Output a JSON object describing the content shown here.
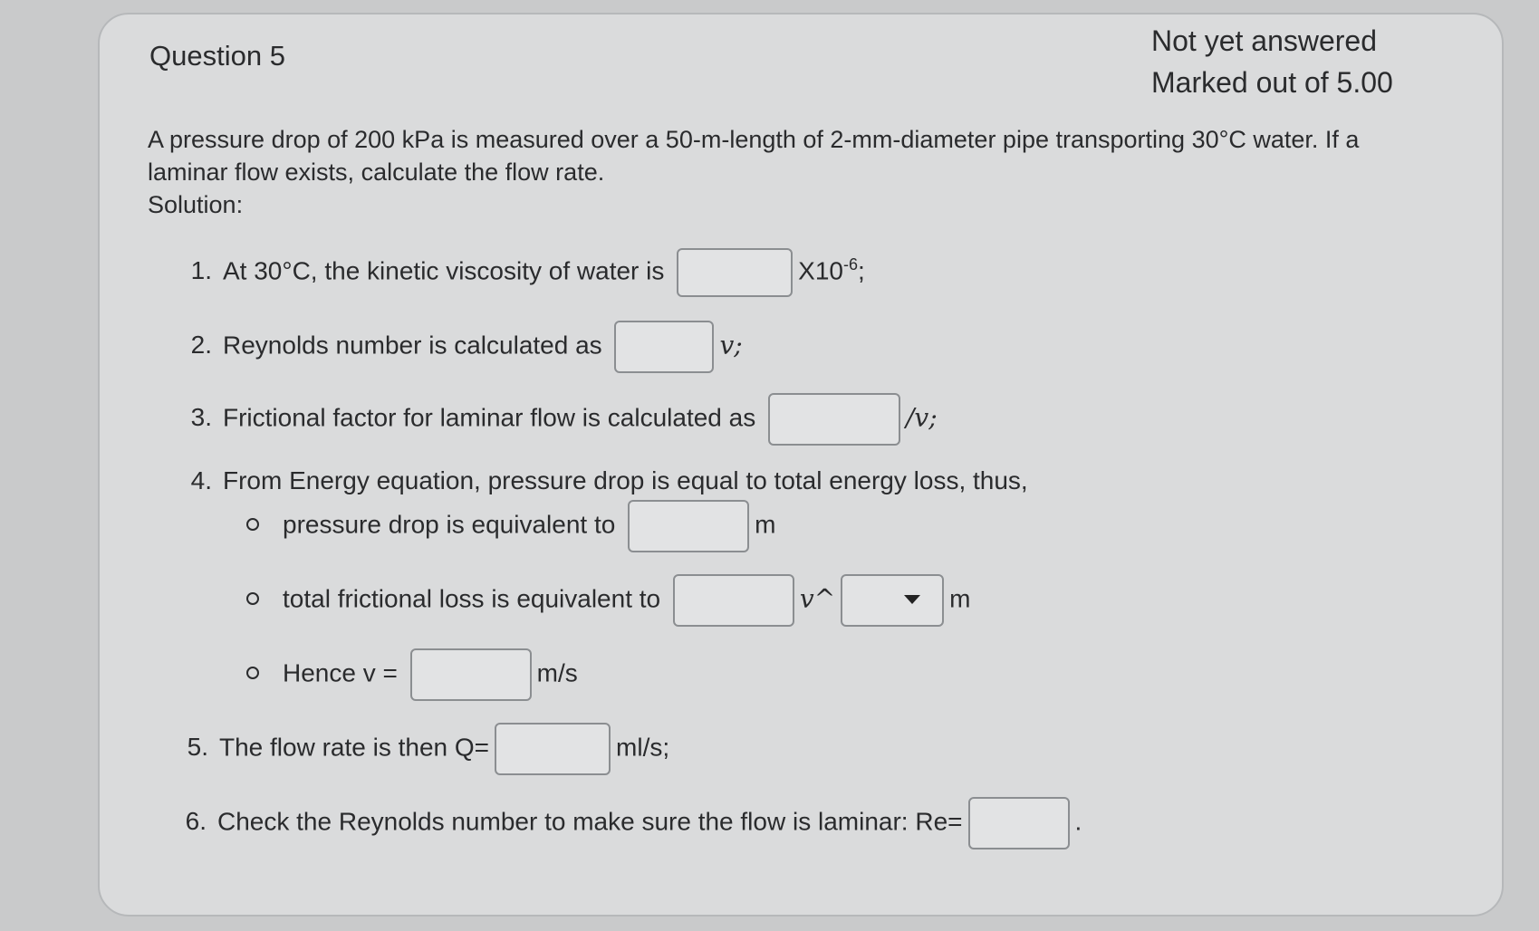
{
  "question": {
    "title": "Question 5",
    "status": "Not yet answered",
    "marks": "Marked out of 5.00"
  },
  "prompt": {
    "text": "A pressure drop of 200 kPa is measured over a 50-m-length of 2-mm-diameter pipe transporting 30°C water. If a laminar flow exists, calculate the flow rate.",
    "solution_label": "Solution:"
  },
  "steps": [
    {
      "num": "1.",
      "text": "At 30°C, the kinetic viscosity of water is",
      "suffix": "X10",
      "exp": "-6",
      "end": ";"
    },
    {
      "num": "2.",
      "text": "Reynolds number is calculated as",
      "suffix": "v;"
    },
    {
      "num": "3.",
      "text": "Frictional factor for laminar flow is calculated as",
      "suffix": "/v;"
    },
    {
      "num": "4.",
      "text": "From Energy equation, pressure drop is equal to total energy loss, thus,"
    },
    {
      "num": "5.",
      "text": "The flow rate is then Q=",
      "suffix": "ml/s;"
    },
    {
      "num": "6.",
      "text": "Check the Reynolds number to make sure the flow is laminar: Re=",
      "suffix": "."
    }
  ],
  "substeps": [
    {
      "text": "pressure drop is equivalent to",
      "suffix": "m"
    },
    {
      "text": "total frictional loss is equivalent to",
      "mid": "v^",
      "suffix": "m",
      "select_value": ""
    },
    {
      "text": "Hence v =",
      "suffix": "m/s"
    }
  ],
  "answers": {
    "a1": "",
    "a2": "",
    "a3": "",
    "a4a": "",
    "a4b": "",
    "a4c": "",
    "a5": "",
    "a6": ""
  }
}
